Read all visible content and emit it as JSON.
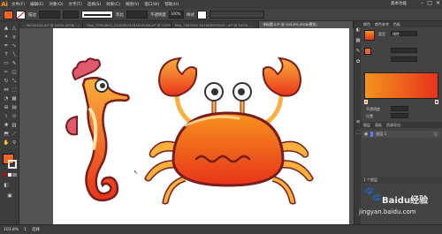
{
  "app": {
    "logo": "Ai",
    "workspace": "基本功能"
  },
  "menu": [
    "文件(F)",
    "编辑(E)",
    "对象(O)",
    "文字(T)",
    "选择(S)",
    "效果(C)",
    "视图(V)",
    "窗口(W)",
    "帮助(H)"
  ],
  "window_controls": [
    "–",
    "□",
    "✕"
  ],
  "control_bar": {
    "fill_color": "#f26522",
    "stroke_label": "描边",
    "uniform_label": "等比",
    "style_label": "不透明度",
    "opacity_value": "100%",
    "opacity_label": "样式"
  },
  "tabs": [
    {
      "label": "...9d01b142.ai* @ 100% (RGB/...)",
      "active": false
    },
    {
      "label": "Mos_70934621_20160825161616146.ai* @ 100% ...",
      "active": false
    },
    {
      "label": "Mos_7063491 201608251003...ai* @ 100% ...",
      "active": false
    },
    {
      "label": "未标题-23* @ 103.8% (RGB/预览)",
      "active": true
    }
  ],
  "colors": {
    "orange": "#f26522",
    "orange_light": "#f7931e",
    "yellow": "#fbb03b",
    "dark_red": "#8b1d1d",
    "pink": "#e05a6d"
  },
  "right_panel": {
    "tabs": [
      "颜色",
      "颜色参考",
      "色板"
    ],
    "type_label": "类型",
    "type_value": "线性",
    "angle_label": "",
    "opacity_label": "不透明度",
    "position_label": "位置",
    "layers_tabs": [
      "图层",
      "画板",
      "资源导出"
    ],
    "layer_name": "图层 1",
    "layer_count": "1 个图层"
  },
  "status": {
    "zoom": "103.8%",
    "page": "1",
    "tool": "选择"
  },
  "watermark": {
    "brand": "Baidu经验",
    "url": "jingyan.baidu.com"
  }
}
